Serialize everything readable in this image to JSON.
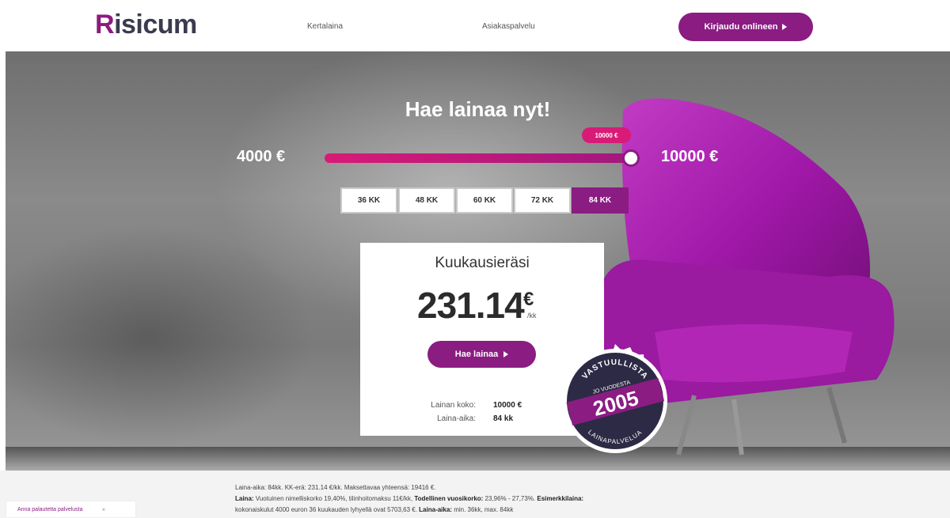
{
  "header": {
    "logo_r": "R",
    "logo_rest": "isicum",
    "nav": {
      "kertalaina": "Kertalaina",
      "asiakaspalvelu": "Asiakaspalvelu"
    },
    "login_label": "Kirjaudu onlineen"
  },
  "hero": {
    "title": "Hae lainaa nyt!",
    "min_amount": "4000 €",
    "max_amount": "10000 €",
    "slider_value_label": "10000 €",
    "slider_fill": 1.0,
    "terms": [
      "36 KK",
      "48 KK",
      "60 KK",
      "72 KK",
      "84 KK"
    ],
    "active_term": "84 KK"
  },
  "card": {
    "title": "Kuukausieräsi",
    "amount": "231.14",
    "currency": "€",
    "per": "/kk",
    "apply_label": "Hae lainaa",
    "summary": {
      "size_label": "Lainan koko:",
      "size_value": "10000 €",
      "term_label": "Laina-aika:",
      "term_value": "84 kk"
    }
  },
  "badge": {
    "top_text": "VASTUULLISTA",
    "middle_text": "JO VUODESTA",
    "year": "2005",
    "bottom_text": "LAINAPALVELUA"
  },
  "footer": {
    "line1": "Laina-aika: 84kk. KK-erä: 231.14 €/kk. Maksettavaa yhteensä: 19416 €.",
    "line2_label_laina": "Laina:",
    "line2_text": " Vuotuinen nimelliskorko 19,40%, tilinhoitomaksu 11€/kk, ",
    "line2_label_todellinen": "Todellinen vuosikorko:",
    "line2_text2": " 23,96% - 27,73%. ",
    "line2_label_esimerkki": "Esimerkkilaina:",
    "line3_text": "kokonaiskulut 4000 euron 36 kuukauden lyhyellä ovat 5703,63 €. ",
    "line3_label": "Laina-aika:",
    "line3_text2": " min. 36kk, max. 84kk",
    "feedback_label": "Anna palautetta palvelusta",
    "feedback_close": "×"
  },
  "colors": {
    "brand": "#8b1c82",
    "accent_pink": "#d81b77"
  }
}
